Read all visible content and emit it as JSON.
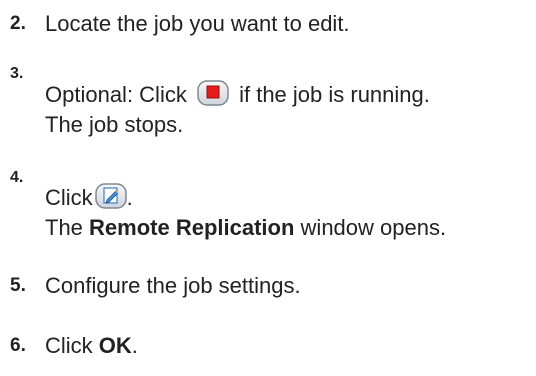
{
  "steps": [
    {
      "number": "2.",
      "text": "Locate the job you want to edit."
    },
    {
      "number": "3.",
      "text_before_icon": "Optional: Click",
      "icon": "stop-icon",
      "text_after_icon": "if the job is running.",
      "result": "The job stops."
    },
    {
      "number": "4.",
      "text_before_icon": "Click",
      "icon": "edit-icon",
      "text_after_icon": ".",
      "result_before": "The",
      "result_bold": "Remote Replication",
      "result_after": "window opens."
    },
    {
      "number": "5.",
      "text": "Configure the job settings."
    },
    {
      "number": "6.",
      "text_before": "Click",
      "text_bold": "OK",
      "text_after": "."
    }
  ],
  "colors": {
    "stop_red": "#e31b1b",
    "edit_blue": "#3c7fc9"
  }
}
